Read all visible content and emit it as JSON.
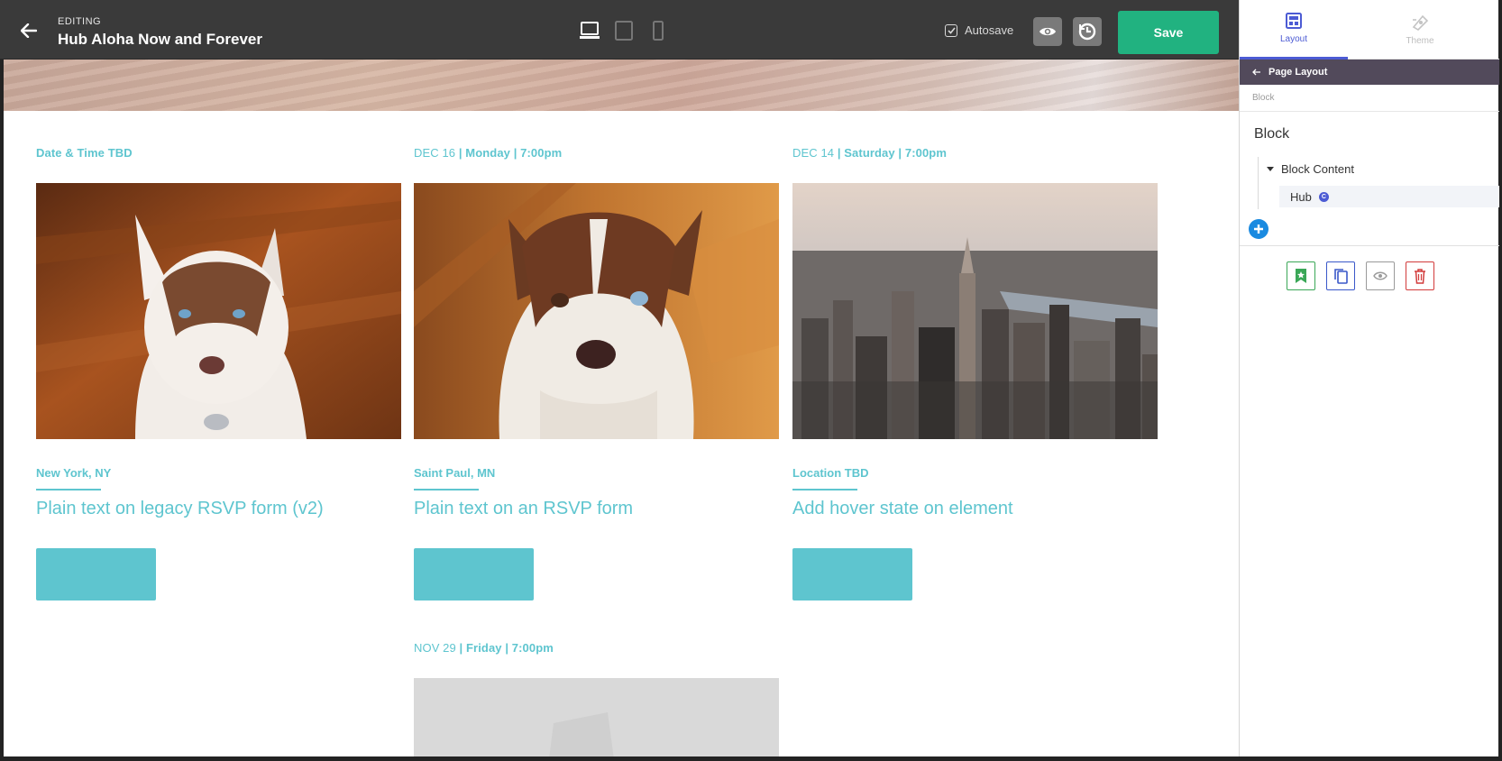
{
  "topbar": {
    "editing_label": "EDITING",
    "page_title": "Hub Aloha Now and Forever",
    "autosave_label": "Autosave",
    "autosave_checked": true,
    "save_label": "Save",
    "devices": [
      "desktop-icon",
      "tablet-icon",
      "mobile-icon"
    ]
  },
  "events": [
    {
      "date": "Date & Time TBD",
      "date_bold": "",
      "location": "New York, NY",
      "title": "Plain text on legacy RSVP form (v2)",
      "image": "husky-dog-photo"
    },
    {
      "date": "DEC 16",
      "date_bold": " | Monday | 7:00pm",
      "location": "Saint Paul, MN",
      "title": "Plain text on an RSVP form",
      "image": "husky-dog-closeup-photo"
    },
    {
      "date": "DEC 14",
      "date_bold": " | Saturday | 7:00pm",
      "location": "Location TBD",
      "title": "Add hover state on element",
      "image": "city-skyline-photo"
    },
    {
      "date": "NOV 29",
      "date_bold": " | Friday | 7:00pm",
      "location": "",
      "title": "",
      "image": "placeholder-image"
    }
  ],
  "panel": {
    "tabs": [
      {
        "label": "Layout",
        "icon": "layout-icon",
        "active": true
      },
      {
        "label": "Theme",
        "icon": "theme-icon",
        "active": false
      }
    ],
    "back_label": "Page Layout",
    "breadcrumb": "Block",
    "heading": "Block",
    "tree": {
      "parent": "Block Content",
      "child": "Hub",
      "child_badge": "C"
    }
  },
  "colors": {
    "accent": "#5ec5cf",
    "save": "#21b280",
    "panel_accent": "#4c5bd4",
    "topbar": "#3a3a3a"
  }
}
